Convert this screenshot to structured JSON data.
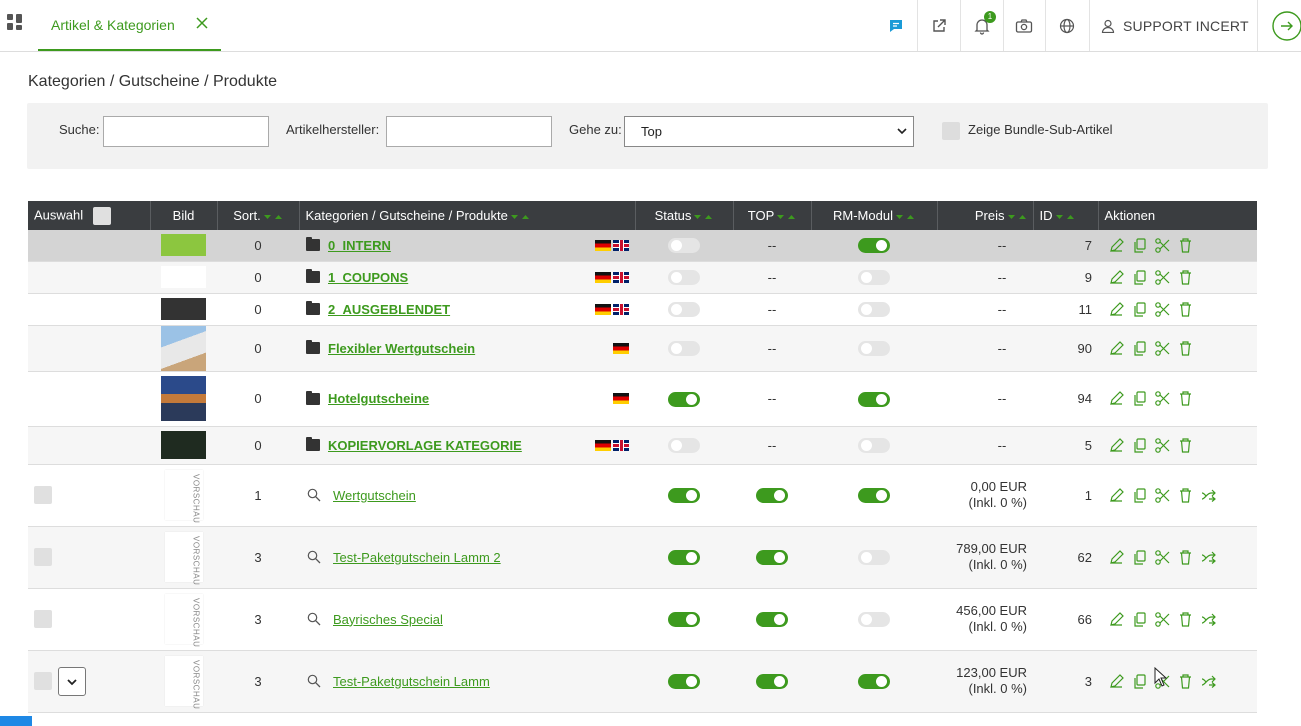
{
  "header": {
    "tab_label": "Artikel & Kategorien",
    "notification_count": "1",
    "user_label": "SUPPORT INCERT"
  },
  "breadcrumb": "Kategorien / Gutscheine / Produkte",
  "filter": {
    "search_label": "Suche:",
    "search_value": "",
    "manufacturer_label": "Artikelhersteller:",
    "manufacturer_value": "",
    "goto_label": "Gehe zu:",
    "goto_value": "Top",
    "bundle_label": "Zeige Bundle-Sub-Artikel"
  },
  "table": {
    "headers": {
      "auswahl": "Auswahl",
      "bild": "Bild",
      "sort": "Sort.",
      "name": "Kategorien / Gutscheine / Produkte",
      "status": "Status",
      "top": "TOP",
      "rm": "RM-Modul",
      "preis": "Preis",
      "id": "ID",
      "aktionen": "Aktionen"
    },
    "categories": [
      {
        "sort": "0",
        "name": "0_INTERN",
        "status": false,
        "top": "--",
        "rm": true,
        "price": "--",
        "id": "7"
      },
      {
        "sort": "0",
        "name": "1_COUPONS",
        "status": false,
        "top": "--",
        "rm": false,
        "price": "--",
        "id": "9"
      },
      {
        "sort": "0",
        "name": "2_AUSGEBLENDET",
        "status": false,
        "top": "--",
        "rm": false,
        "price": "--",
        "id": "11"
      },
      {
        "sort": "0",
        "name": "Flexibler Wertgutschein",
        "status": false,
        "top": "--",
        "rm": false,
        "price": "--",
        "id": "90"
      },
      {
        "sort": "0",
        "name": "Hotelgutscheine",
        "status": true,
        "top": "--",
        "rm": true,
        "price": "--",
        "id": "94"
      },
      {
        "sort": "0",
        "name": "KOPIERVORLAGE KATEGORIE",
        "status": false,
        "top": "--",
        "rm": false,
        "price": "--",
        "id": "5"
      }
    ],
    "products": [
      {
        "sort": "1",
        "name": "Wertgutschein",
        "status": true,
        "top": true,
        "rm": true,
        "price": "0,00 EUR",
        "price_note": "(Inkl. 0 %)",
        "id": "1"
      },
      {
        "sort": "3",
        "name": "Test-Paketgutschein Lamm 2",
        "status": true,
        "top": true,
        "rm": false,
        "price": "789,00 EUR",
        "price_note": "(Inkl. 0 %)",
        "id": "62"
      },
      {
        "sort": "3",
        "name": "Bayrisches Special",
        "status": true,
        "top": true,
        "rm": false,
        "price": "456,00 EUR",
        "price_note": "(Inkl. 0 %)",
        "id": "66"
      },
      {
        "sort": "3",
        "name": "Test-Paketgutschein Lamm",
        "status": true,
        "top": true,
        "rm": true,
        "price": "123,00 EUR",
        "price_note": "(Inkl. 0 %)",
        "id": "3"
      }
    ],
    "thumbnail_text": "VORSCHAU"
  },
  "colors": {
    "accent": "#3d9a1e",
    "header_bg": "#3a3d40",
    "selected_row": "#d4d4d4"
  }
}
